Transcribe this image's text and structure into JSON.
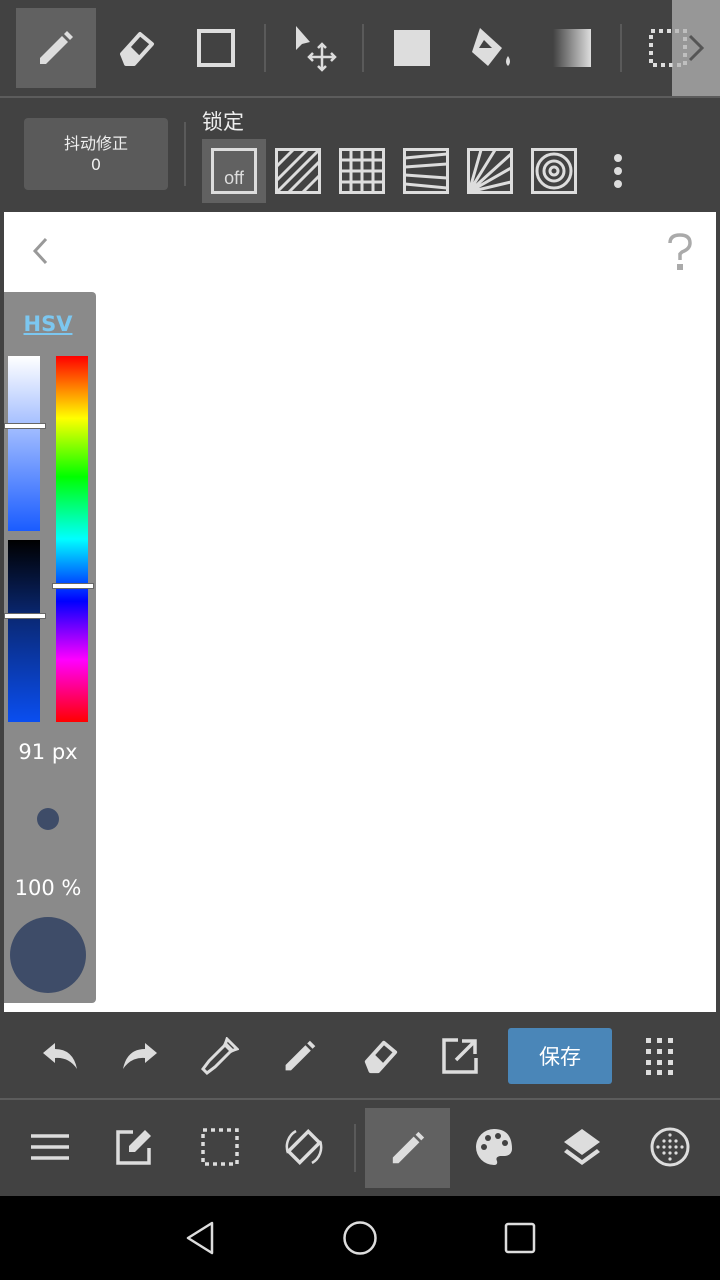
{
  "top_toolbar": {
    "tools": [
      {
        "icon": "pen-icon",
        "selected": true
      },
      {
        "icon": "eraser-icon"
      },
      {
        "icon": "rectangle-icon"
      },
      {
        "icon": "move-icon"
      },
      {
        "icon": "fill-rect-icon"
      },
      {
        "icon": "bucket-icon"
      },
      {
        "icon": "gradient-icon"
      },
      {
        "icon": "selection-icon"
      }
    ],
    "expand_icon": "chevron-right-icon"
  },
  "sub_toolbar": {
    "stabilizer_label": "抖动修正",
    "stabilizer_value": "0",
    "snap_label": "锁定",
    "snap_off_label": "off",
    "snap_options": [
      "off",
      "parallel",
      "grid",
      "perspective",
      "radial",
      "concentric"
    ],
    "snap_selected": "off"
  },
  "canvas": {
    "back_icon": "chevron-left-icon",
    "help_icon": "question-icon"
  },
  "color_panel": {
    "mode_label": "HSV",
    "saturation_fraction": 0.59,
    "value_fraction": 0.58,
    "hue_fraction": 0.63,
    "brush_size": "91 px",
    "opacity": "100 %",
    "current_color": "#3e4c68"
  },
  "bottom_toolbar": {
    "undo_icon": "undo-icon",
    "redo_icon": "redo-icon",
    "save_label": "保存",
    "save_color": "#4a86b8"
  },
  "nav_bar": {
    "items": [
      "menu",
      "edit",
      "selection",
      "rotate",
      "pen",
      "palette",
      "layers",
      "material"
    ],
    "selected": "pen"
  }
}
